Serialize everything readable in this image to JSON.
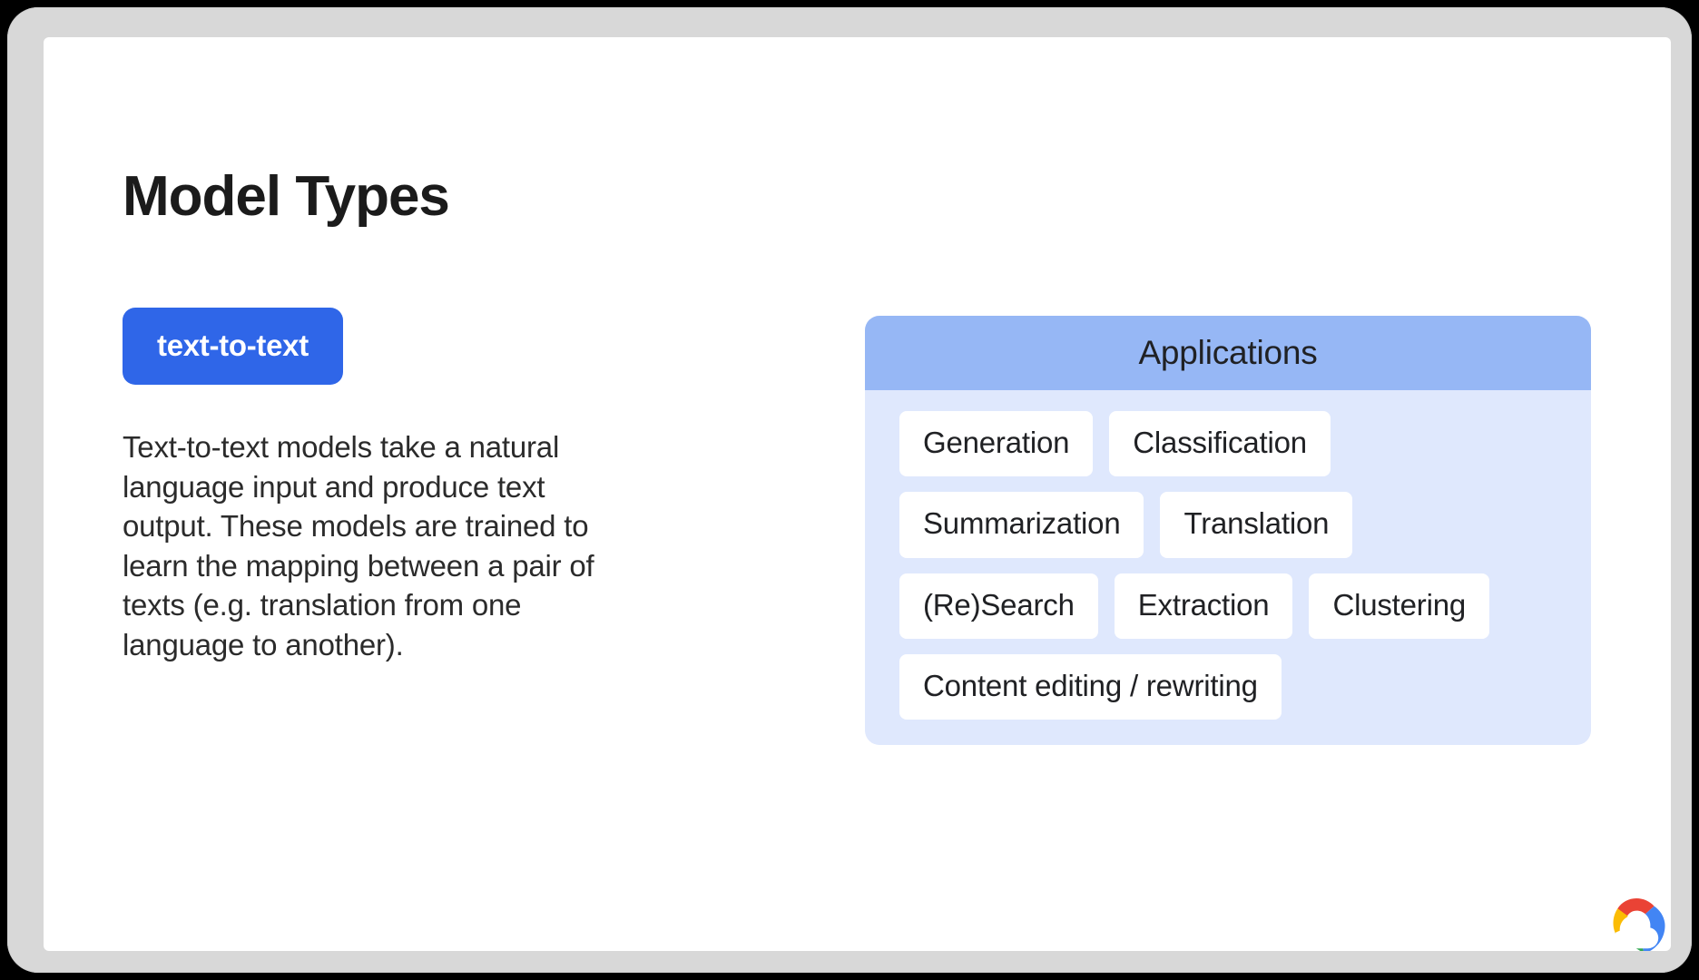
{
  "slide": {
    "title": "Model Types",
    "brand_logo": "google-cloud-logo"
  },
  "model_type": {
    "badge_label": "text-to-text",
    "description": "Text-to-text models take a natural language input and produce text output. These models are trained to learn the mapping between a pair of texts (e.g. translation from one language to another)."
  },
  "applications": {
    "header": "Applications",
    "rows": [
      {
        "chips": [
          "Generation",
          "Classification"
        ]
      },
      {
        "chips": [
          "Summarization",
          "Translation"
        ]
      },
      {
        "chips": [
          "(Re)Search",
          "Extraction",
          "Clustering"
        ]
      },
      {
        "chips": [
          "Content editing / rewriting"
        ]
      }
    ]
  },
  "colors": {
    "badge_blue": "#2f66e8",
    "panel_header_blue": "#96b7f5",
    "panel_body_blue": "#dfe8fd",
    "chip_white": "#ffffff",
    "slide_frame_gray": "#d8d8d8",
    "text_dark": "#202124",
    "google_red": "#ea4335",
    "google_blue": "#4285f4",
    "google_yellow": "#fbbc04",
    "google_green": "#34a853"
  }
}
